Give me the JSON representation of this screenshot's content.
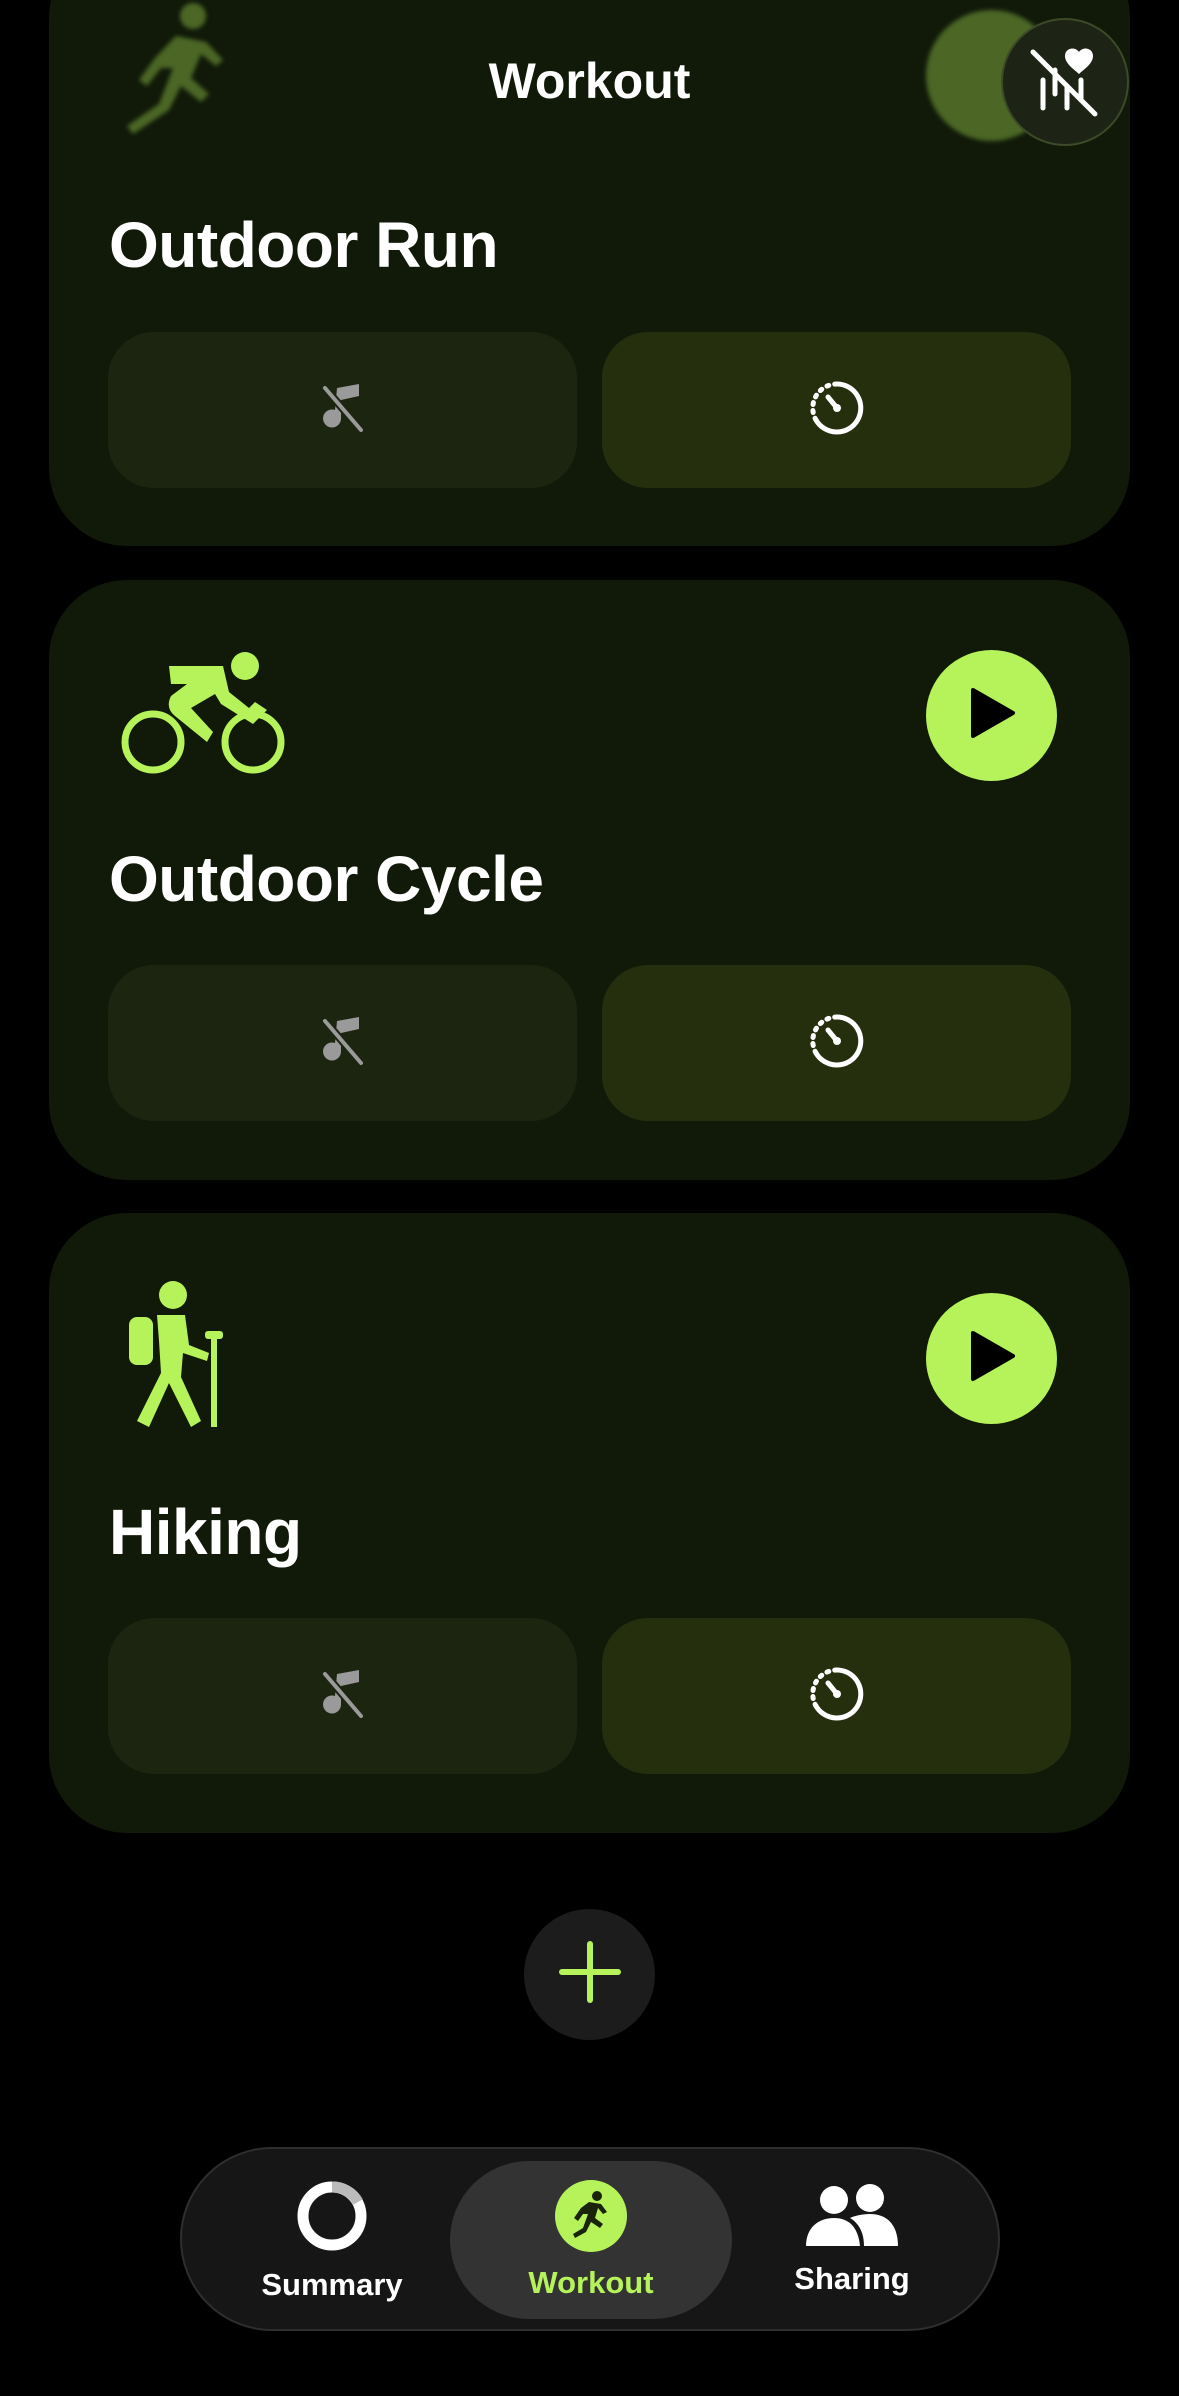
{
  "header": {
    "title": "Workout"
  },
  "colors": {
    "accent": "#b6f35a",
    "card_bg": "#111a09",
    "music_btn_bg": "#1c2510",
    "goal_btn_bg": "#252f0e"
  },
  "workouts": [
    {
      "name": "Outdoor Run",
      "icon": "running-figure-icon"
    },
    {
      "name": "Outdoor Cycle",
      "icon": "cycling-figure-icon"
    },
    {
      "name": "Hiking",
      "icon": "hiking-figure-icon"
    }
  ],
  "tabs": [
    {
      "label": "Summary",
      "icon": "activity-ring-icon",
      "active": false
    },
    {
      "label": "Workout",
      "icon": "workout-figure-icon",
      "active": true
    },
    {
      "label": "Sharing",
      "icon": "people-icon",
      "active": false
    }
  ]
}
